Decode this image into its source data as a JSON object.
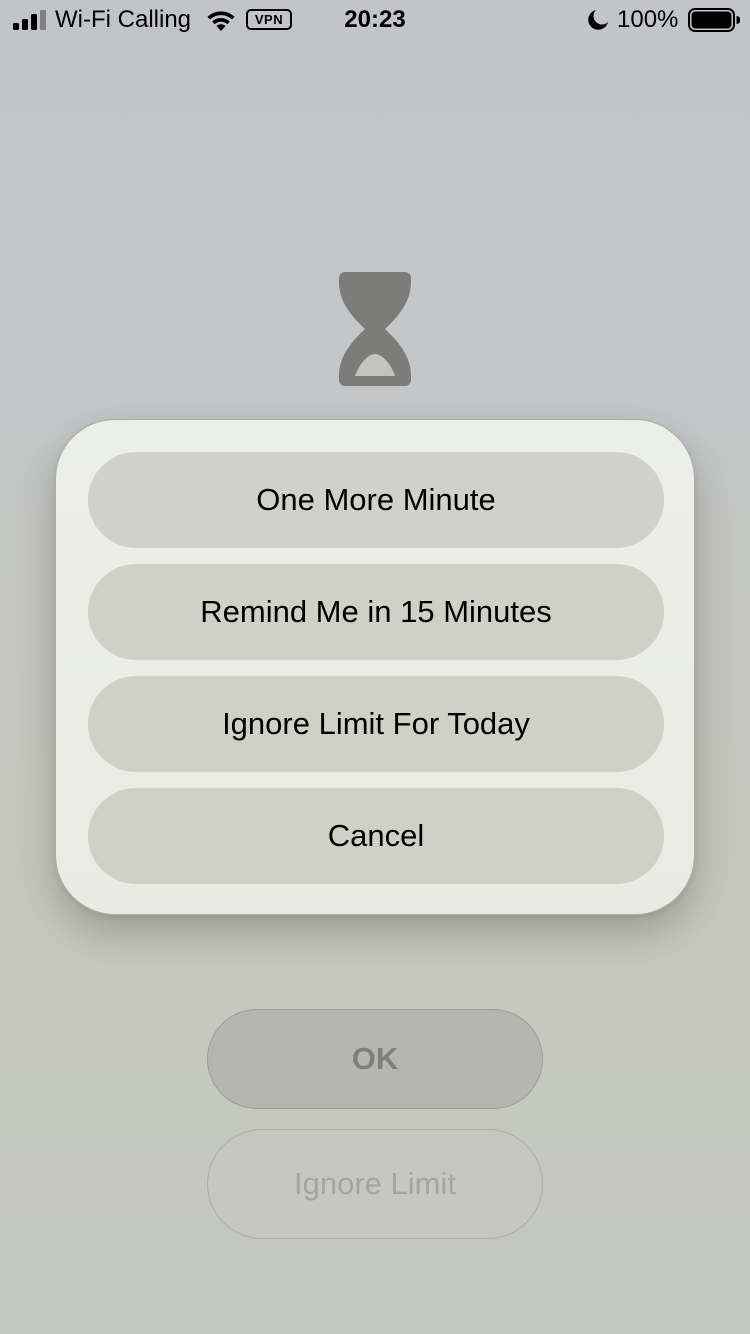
{
  "status_bar": {
    "carrier": "Wi-Fi Calling",
    "vpn": "VPN",
    "time": "20:23",
    "battery": "100%",
    "icons": [
      "signal-icon",
      "wifi-icon",
      "moon-icon",
      "battery-icon"
    ]
  },
  "screen_time": {
    "icon": "hourglass-icon",
    "ok_label": "OK",
    "ignore_limit_label": "Ignore Limit"
  },
  "action_sheet": {
    "options": [
      "One More Minute",
      "Remind Me in 15 Minutes",
      "Ignore Limit For Today",
      "Cancel"
    ]
  },
  "colors": {
    "icon_gray": "#808080",
    "button_fill": "#cfd0c6",
    "sheet_fill": "#eceee8"
  }
}
